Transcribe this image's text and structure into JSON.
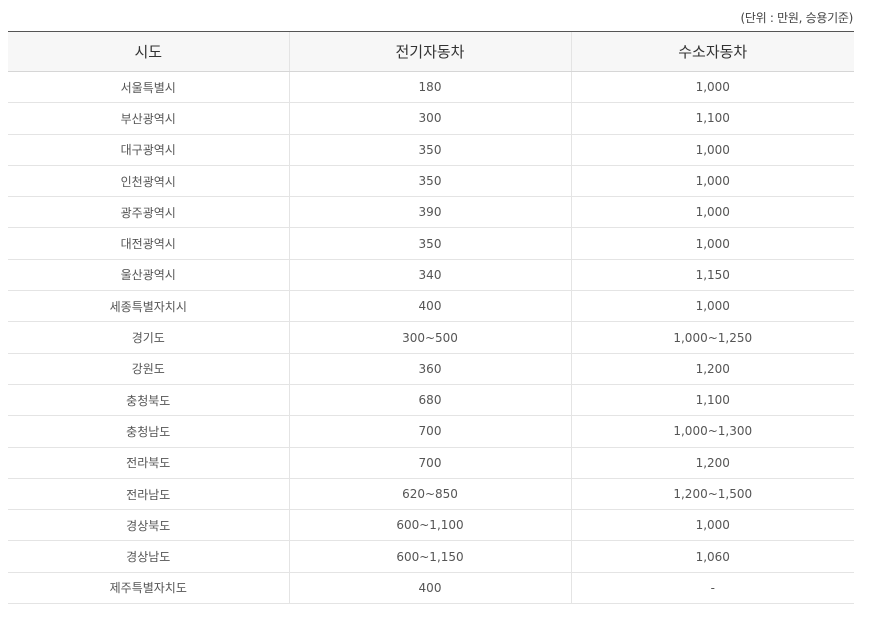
{
  "unit_note": "(단위 : 만원, 승용기준)",
  "table": {
    "headers": [
      "시도",
      "전기자동차",
      "수소자동차"
    ],
    "rows": [
      [
        "서울특별시",
        "180",
        "1,000"
      ],
      [
        "부산광역시",
        "300",
        "1,100"
      ],
      [
        "대구광역시",
        "350",
        "1,000"
      ],
      [
        "인천광역시",
        "350",
        "1,000"
      ],
      [
        "광주광역시",
        "390",
        "1,000"
      ],
      [
        "대전광역시",
        "350",
        "1,000"
      ],
      [
        "울산광역시",
        "340",
        "1,150"
      ],
      [
        "세종특별자치시",
        "400",
        "1,000"
      ],
      [
        "경기도",
        "300~500",
        "1,000~1,250"
      ],
      [
        "강원도",
        "360",
        "1,200"
      ],
      [
        "충청북도",
        "680",
        "1,100"
      ],
      [
        "충청남도",
        "700",
        "1,000~1,300"
      ],
      [
        "전라북도",
        "700",
        "1,200"
      ],
      [
        "전라남도",
        "620~850",
        "1,200~1,500"
      ],
      [
        "경상북도",
        "600~1,100",
        "1,000"
      ],
      [
        "경상남도",
        "600~1,150",
        "1,060"
      ],
      [
        "제주특별자치도",
        "400",
        "-"
      ]
    ]
  }
}
